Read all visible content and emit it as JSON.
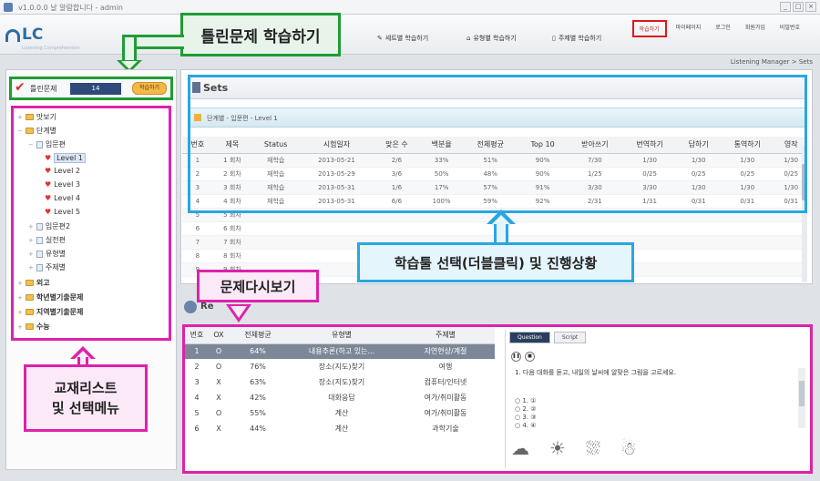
{
  "titlebar": {
    "title": "v1.0.0.0 날 알람합니다 - admin",
    "controls": [
      "_",
      "□",
      "×"
    ]
  },
  "app": {
    "logo": "LC",
    "logo_sub": "Listening Comprehension"
  },
  "topmenu": {
    "items": [
      "학습하기",
      "마이페이지",
      "로그인",
      "회원가입",
      "비밀번호"
    ],
    "active": "학습하기"
  },
  "navtabs": [
    "세트별 학습하기",
    "유형별 학습하기",
    "주제별 학습하기"
  ],
  "breadcrumb": "Listening Manager > Sets",
  "callouts": {
    "wrong": "틀린문제 학습하기",
    "textbook": "교재리스트\n및 선택메뉴",
    "sets": "학습툴 선택(더블클릭) 및 진행상황",
    "review": "문제다시보기"
  },
  "wrong": {
    "label": "틀린문제",
    "count": "14",
    "button": "학습하기"
  },
  "tree": {
    "items": [
      {
        "label": "맛보기",
        "type": "folder",
        "level": 0
      },
      {
        "label": "단계별",
        "type": "folder",
        "level": 0
      },
      {
        "label": "입문편",
        "type": "page",
        "level": 1
      },
      {
        "label": "Level 1",
        "type": "pin",
        "level": 2,
        "selected": true
      },
      {
        "label": "Level 2",
        "type": "pin",
        "level": 2
      },
      {
        "label": "Level 3",
        "type": "pin",
        "level": 2
      },
      {
        "label": "Level 4",
        "type": "pin",
        "level": 2
      },
      {
        "label": "Level 5",
        "type": "pin",
        "level": 2
      },
      {
        "label": "입문편2",
        "type": "page",
        "level": 1
      },
      {
        "label": "실전편",
        "type": "page",
        "level": 1
      },
      {
        "label": "유형별",
        "type": "page",
        "level": 1
      },
      {
        "label": "주제별",
        "type": "page",
        "level": 1
      },
      {
        "label": "외고",
        "type": "folder",
        "level": 0
      },
      {
        "label": "학년별기출문제",
        "type": "folder",
        "level": 0
      },
      {
        "label": "지역별기출문제",
        "type": "folder",
        "level": 0
      },
      {
        "label": "수능",
        "type": "folder",
        "level": 0
      }
    ]
  },
  "sets": {
    "title": "Sets",
    "subtitle": "단계별 - 입문편 - Level 1",
    "columns": [
      "번호",
      "제목",
      "Status",
      "시험일자",
      "맞은 수",
      "백분율",
      "전체평균",
      "Top 10",
      "받아쓰기",
      "번역하기",
      "답하기",
      "통역하기",
      "영작"
    ],
    "rows": [
      [
        "1",
        "1 회차",
        "재학습",
        "2013-05-21",
        "2/6",
        "33%",
        "51%",
        "90%",
        "7/30",
        "1/30",
        "1/30",
        "1/30",
        "1/30"
      ],
      [
        "2",
        "2 회차",
        "재학습",
        "2013-05-29",
        "3/6",
        "50%",
        "48%",
        "90%",
        "1/25",
        "0/25",
        "0/25",
        "0/25",
        "0/25"
      ],
      [
        "3",
        "3 회차",
        "재학습",
        "2013-05-31",
        "1/6",
        "17%",
        "57%",
        "91%",
        "3/30",
        "3/30",
        "1/30",
        "1/30",
        "1/30"
      ],
      [
        "4",
        "4 회차",
        "재학습",
        "2013-05-31",
        "6/6",
        "100%",
        "59%",
        "92%",
        "2/31",
        "1/31",
        "0/31",
        "0/31",
        "0/31"
      ],
      [
        "5",
        "5 회차",
        "",
        "",
        "",
        "",
        "",
        "",
        "",
        "",
        "",
        "",
        ""
      ],
      [
        "6",
        "6 회차",
        "",
        "",
        "",
        "",
        "",
        "",
        "",
        "",
        "",
        "",
        ""
      ],
      [
        "7",
        "7 회차",
        "",
        "",
        "",
        "",
        "",
        "",
        "",
        "",
        "",
        "",
        ""
      ],
      [
        "8",
        "8 회차",
        "",
        "",
        "",
        "",
        "",
        "",
        "",
        "",
        "",
        "",
        ""
      ],
      [
        "9",
        "9 회차",
        "",
        "",
        "",
        "",
        "",
        "",
        "",
        "",
        "",
        "",
        ""
      ]
    ]
  },
  "review": {
    "title": "Re",
    "columns": [
      "번호",
      "OX",
      "전체평균",
      "유형별",
      "주제별"
    ],
    "rows": [
      [
        "1",
        "O",
        "64%",
        "내용추론(하고 있는...",
        "자연현상/계절"
      ],
      [
        "2",
        "O",
        "76%",
        "장소(지도)찾기",
        "여행"
      ],
      [
        "3",
        "X",
        "63%",
        "장소(지도)찾기",
        "컴퓨터/인터넷"
      ],
      [
        "4",
        "X",
        "42%",
        "대화응답",
        "여가/취미활동"
      ],
      [
        "5",
        "O",
        "55%",
        "계산",
        "여가/취미활동"
      ],
      [
        "6",
        "X",
        "44%",
        "계산",
        "과학기술"
      ]
    ],
    "selected_index": 0
  },
  "question": {
    "tabs": [
      "Question",
      "Script"
    ],
    "active_tab": "Question",
    "text": "1. 다음 대화를 듣고, 내일의 날씨에 알맞은 그림을 고르세요.",
    "options": [
      "1. ①",
      "2. ②",
      "3. ③",
      "4. ④"
    ],
    "images": [
      "☁",
      "☀",
      "⛆",
      "☃"
    ]
  }
}
